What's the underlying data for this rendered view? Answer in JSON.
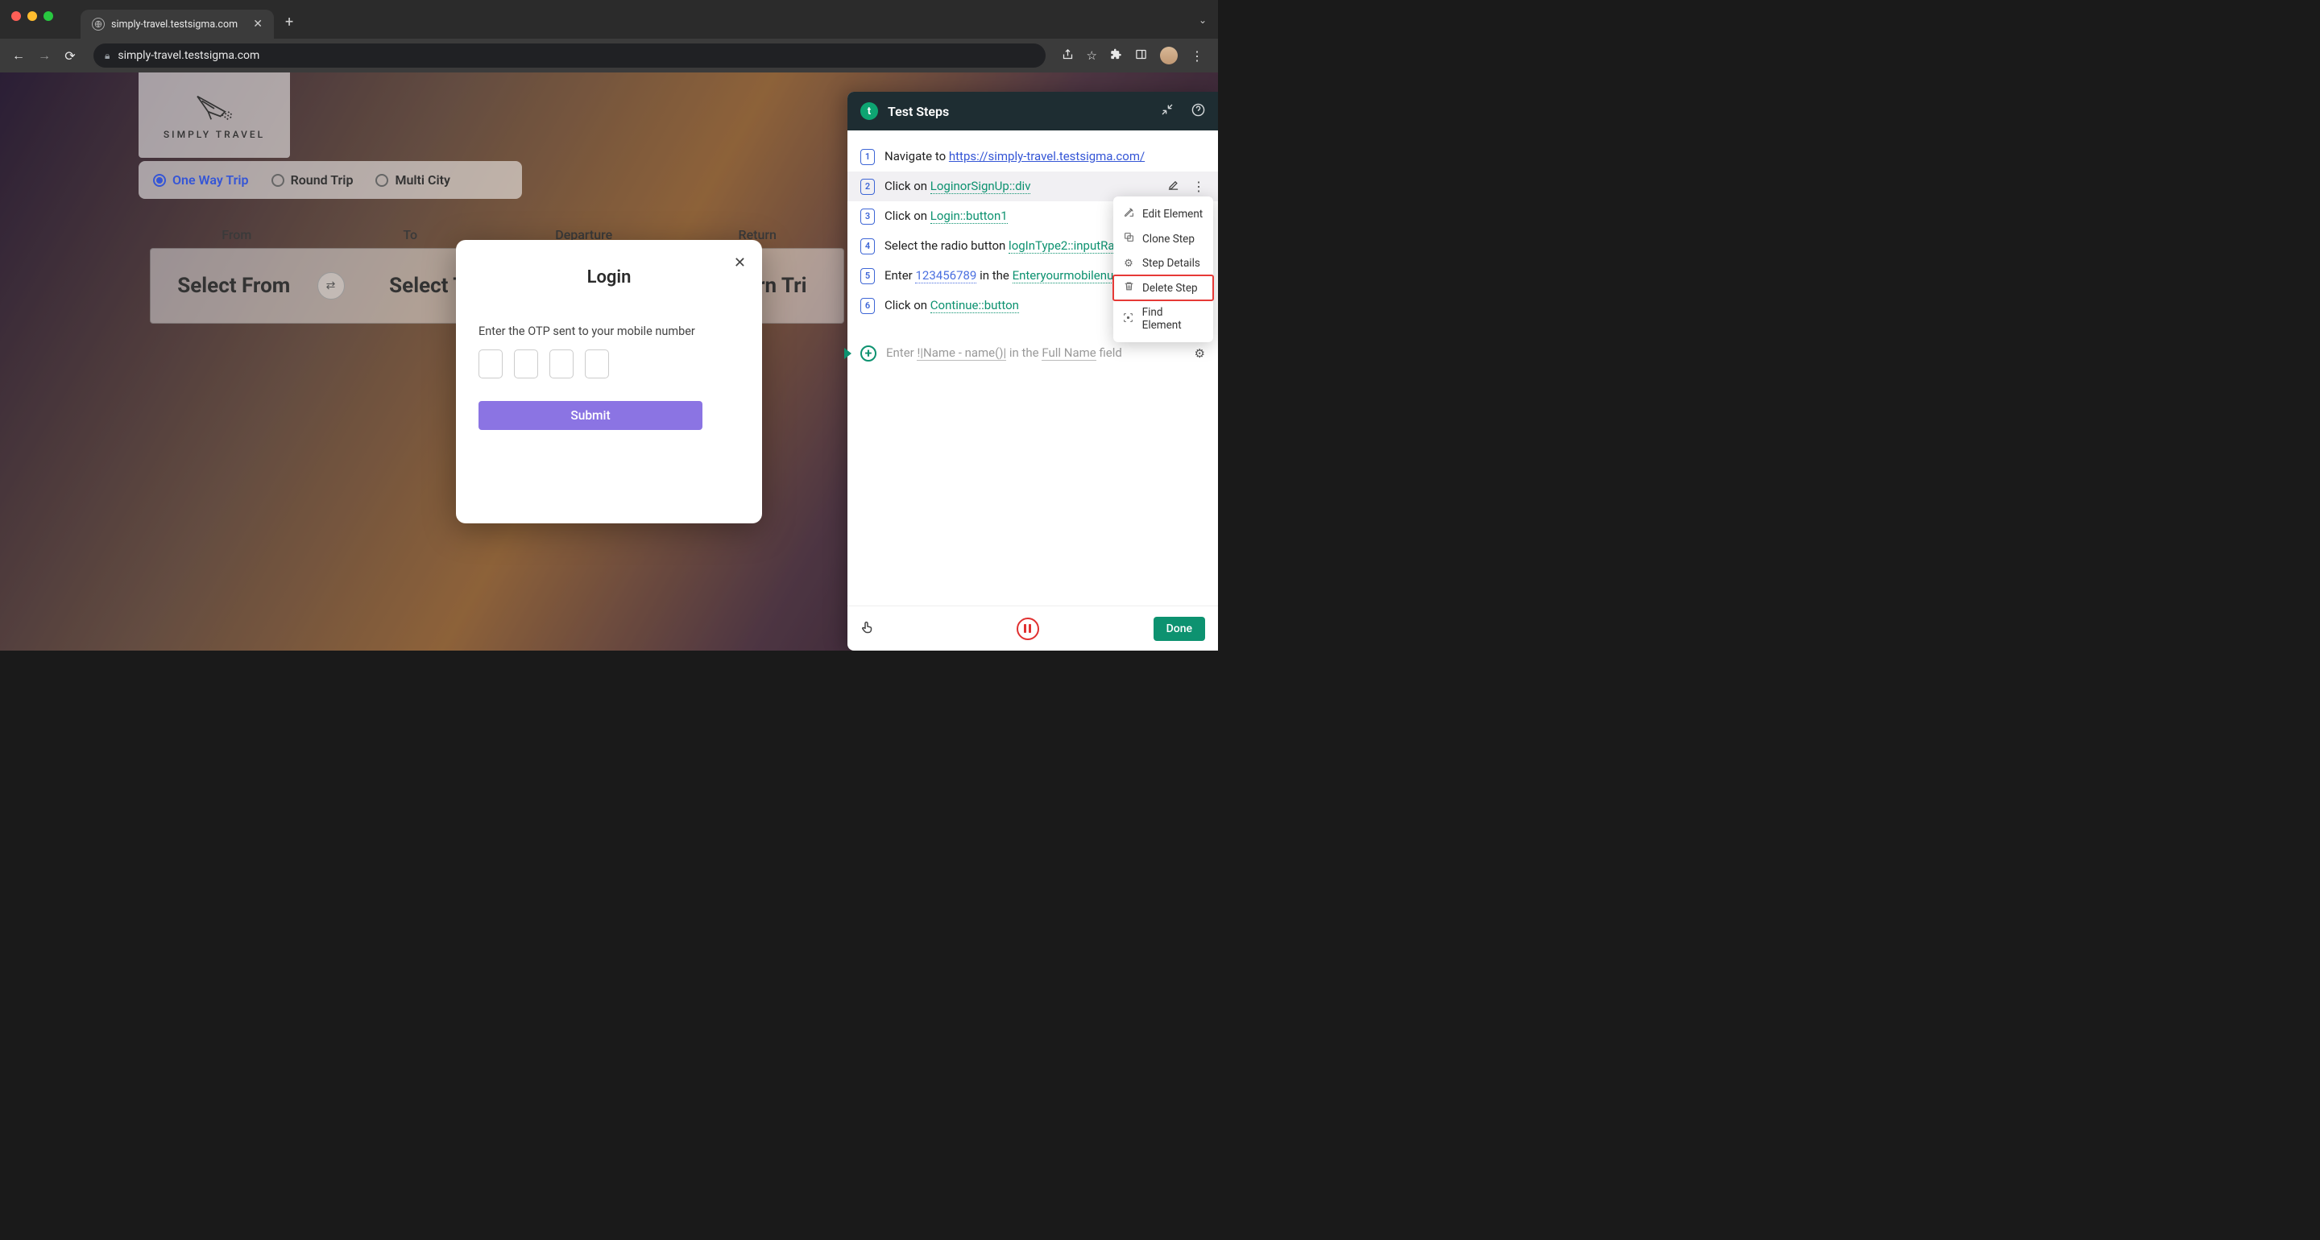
{
  "browser": {
    "tab_title": "simply-travel.testsigma.com",
    "url": "simply-travel.testsigma.com"
  },
  "page": {
    "logo_text": "SIMPLY TRAVEL",
    "trip_types": {
      "one_way": "One Way Trip",
      "round": "Round Trip",
      "multi": "Multi City"
    },
    "field_labels": {
      "from": "From",
      "to": "To",
      "departure": "Departure",
      "return": "Return"
    },
    "field_values": {
      "from": "Select From",
      "to": "Select T",
      "return": "Return Tri"
    }
  },
  "modal": {
    "title": "Login",
    "instruction": "Enter the OTP sent to your mobile number",
    "submit": "Submit"
  },
  "panel": {
    "title": "Test Steps",
    "steps": [
      {
        "num": "1",
        "prefix": "Navigate to ",
        "link": "https://simply-travel.testsigma.com/",
        "link_type": "url"
      },
      {
        "num": "2",
        "prefix": "Click on ",
        "link": "LoginorSignUp::div",
        "link_type": "elem"
      },
      {
        "num": "3",
        "prefix": "Click on ",
        "link": "Login::button1",
        "link_type": "elem"
      },
      {
        "num": "4",
        "prefix": "Select the radio button ",
        "link": "logInType2::inputRa",
        "link_type": "elem"
      },
      {
        "num": "5",
        "prefix": "Enter ",
        "data": "123456789",
        "mid": " in the ",
        "link": "Enteryourmobilenu",
        "link_type": "elem"
      },
      {
        "num": "6",
        "prefix": "Click on ",
        "link": "Continue::button",
        "link_type": "elem"
      }
    ],
    "new_step": {
      "text1": "Enter ",
      "ph1": "!|Name - name()|",
      "text2": " in the ",
      "ph2": "Full Name",
      "text3": " field"
    },
    "ctx_menu": {
      "edit_element": "Edit Element",
      "clone": "Clone Step",
      "details": "Step Details",
      "delete": "Delete Step",
      "find": "Find Element"
    },
    "done": "Done"
  }
}
